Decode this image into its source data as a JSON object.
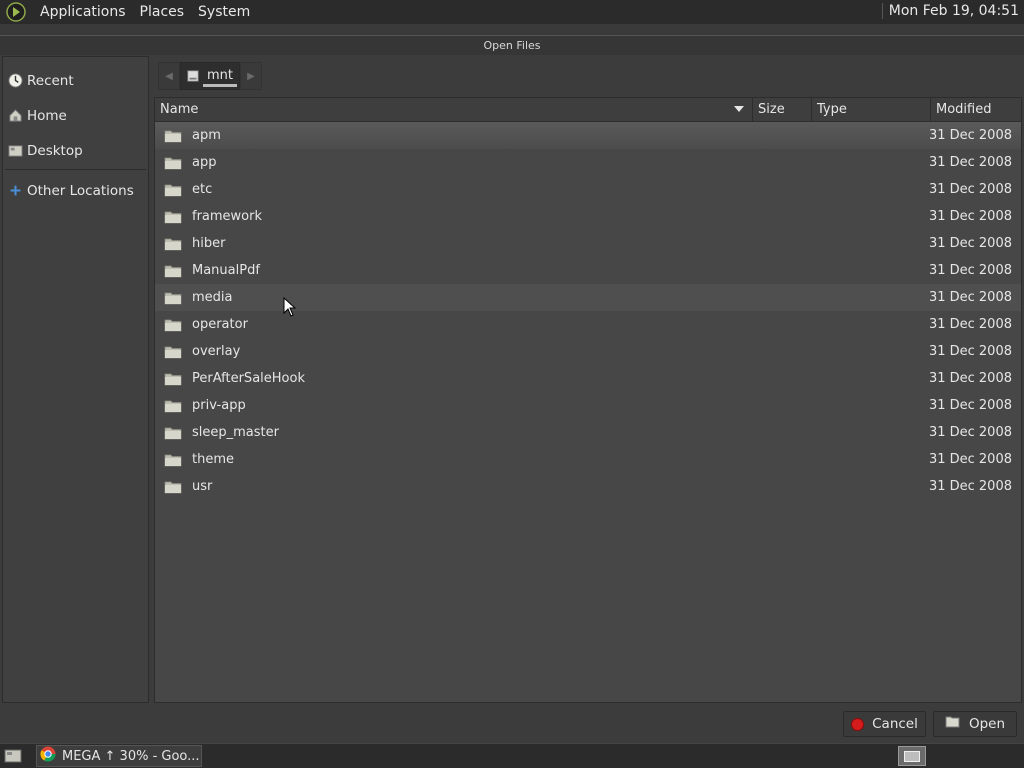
{
  "top_panel": {
    "menus": [
      "Applications",
      "Places",
      "System"
    ],
    "clock": "Mon Feb 19, 04:51"
  },
  "dialog": {
    "title": "Open Files",
    "sidebar": {
      "items": [
        {
          "label": "Recent",
          "icon": "recent-icon"
        },
        {
          "label": "Home",
          "icon": "home-icon"
        },
        {
          "label": "Desktop",
          "icon": "desktop-icon"
        }
      ],
      "other_locations": {
        "label": "Other Locations",
        "icon": "plus-icon"
      }
    },
    "pathbar": {
      "current": "mnt"
    },
    "columns": {
      "name": "Name",
      "size": "Size",
      "type": "Type",
      "modified": "Modified"
    },
    "files": [
      {
        "name": "apm",
        "modified": "31 Dec 2008"
      },
      {
        "name": "app",
        "modified": "31 Dec 2008"
      },
      {
        "name": "etc",
        "modified": "31 Dec 2008"
      },
      {
        "name": "framework",
        "modified": "31 Dec 2008"
      },
      {
        "name": "hiber",
        "modified": "31 Dec 2008"
      },
      {
        "name": "ManualPdf",
        "modified": "31 Dec 2008"
      },
      {
        "name": "media",
        "modified": "31 Dec 2008"
      },
      {
        "name": "operator",
        "modified": "31 Dec 2008"
      },
      {
        "name": "overlay",
        "modified": "31 Dec 2008"
      },
      {
        "name": "PerAfterSaleHook",
        "modified": "31 Dec 2008"
      },
      {
        "name": "priv-app",
        "modified": "31 Dec 2008"
      },
      {
        "name": "sleep_master",
        "modified": "31 Dec 2008"
      },
      {
        "name": "theme",
        "modified": "31 Dec 2008"
      },
      {
        "name": "usr",
        "modified": "31 Dec 2008"
      }
    ],
    "buttons": {
      "cancel": "Cancel",
      "open": "Open"
    }
  },
  "taskbar": {
    "task": "MEGA ↑ 30% - Goo..."
  },
  "colors": {
    "cancel_red": "#d41c1c",
    "selected_row": "#5a5a5a"
  }
}
